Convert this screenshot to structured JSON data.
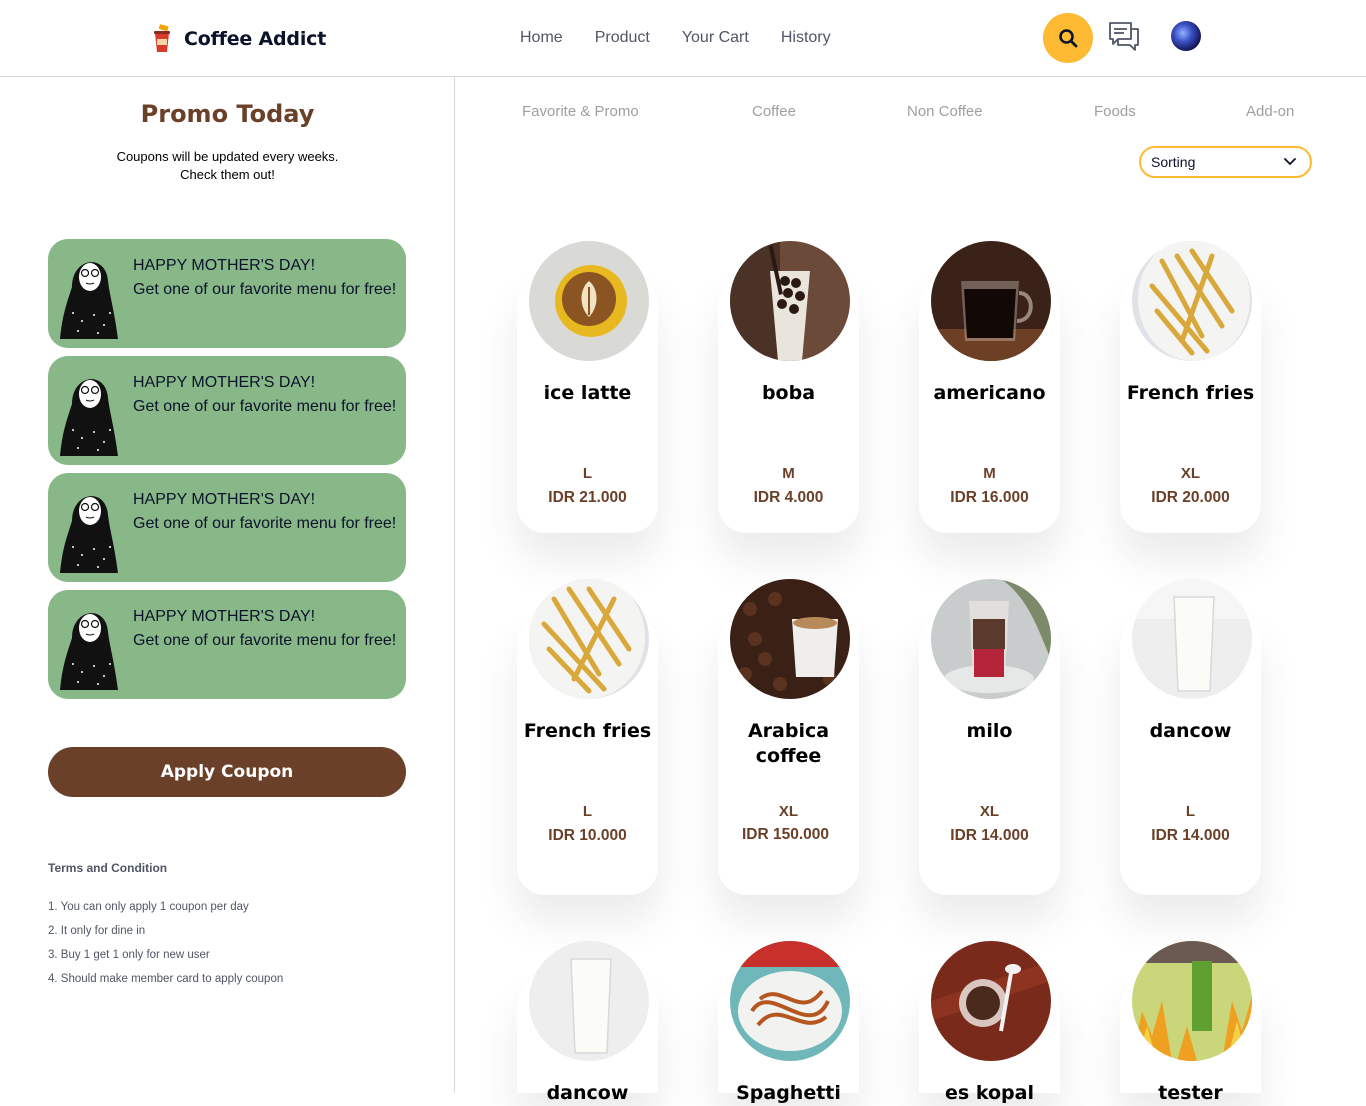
{
  "header": {
    "brand": "Coffee Addict",
    "nav": [
      "Home",
      "Product",
      "Your Cart",
      "History"
    ],
    "accent_color": "#ffba33"
  },
  "promo": {
    "title": "Promo Today",
    "subtitle_line1": "Coupons will be updated every weeks.",
    "subtitle_line2": "Check them out!",
    "coupons": [
      {
        "heading": "HAPPY MOTHER'S DAY!",
        "body": "Get one of our favorite menu for free!"
      },
      {
        "heading": "HAPPY MOTHER'S DAY!",
        "body": "Get one of our favorite menu for free!"
      },
      {
        "heading": "HAPPY MOTHER'S DAY!",
        "body": "Get one of our favorite menu for free!"
      },
      {
        "heading": "HAPPY MOTHER'S DAY!",
        "body": "Get one of our favorite menu for free!"
      }
    ],
    "coupon_color": "#88b788",
    "apply_label": "Apply Coupon",
    "terms_title": "Terms and Condition",
    "terms": [
      "1. You can only apply 1 coupon per day",
      "2. It only for dine in",
      "3. Buy 1 get 1 only for new user",
      "4. Should make member card to apply coupon"
    ]
  },
  "categories": [
    "Favorite & Promo",
    "Coffee",
    "Non Coffee",
    "Foods",
    "Add-on"
  ],
  "sorting": {
    "label": "Sorting"
  },
  "products": [
    {
      "name": "ice latte",
      "size": "L",
      "price": "IDR 21.000"
    },
    {
      "name": "boba",
      "size": "M",
      "price": "IDR 4.000"
    },
    {
      "name": "americano",
      "size": "M",
      "price": "IDR 16.000"
    },
    {
      "name": "French fries",
      "size": "XL",
      "price": "IDR 20.000"
    },
    {
      "name": "French fries",
      "size": "L",
      "price": "IDR 10.000"
    },
    {
      "name": "Arabica coffee",
      "size": "XL",
      "price": "IDR 150.000"
    },
    {
      "name": "milo",
      "size": "XL",
      "price": "IDR 14.000"
    },
    {
      "name": "dancow",
      "size": "L",
      "price": "IDR 14.000"
    },
    {
      "name": "dancow",
      "size": "",
      "price": ""
    },
    {
      "name": "Spaghetti",
      "size": "",
      "price": ""
    },
    {
      "name": "es kopal",
      "size": "",
      "price": ""
    },
    {
      "name": "tester",
      "size": "",
      "price": ""
    }
  ],
  "brand_color": "#6a4029"
}
